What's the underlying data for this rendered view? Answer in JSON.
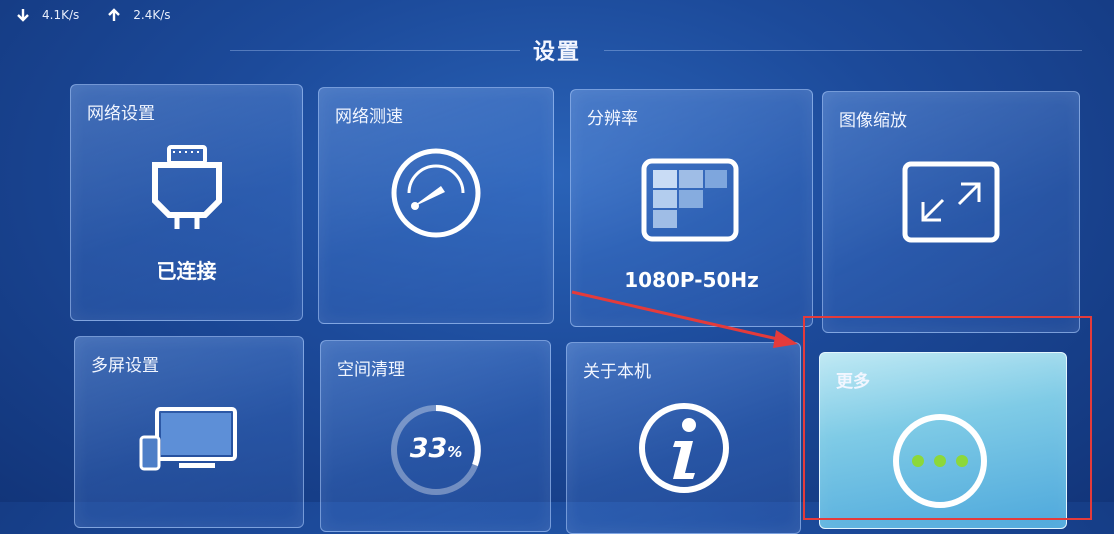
{
  "status": {
    "down_rate": "4.1K/s",
    "up_rate": "2.4K/s"
  },
  "header": {
    "title": "设置"
  },
  "tiles": [
    {
      "label": "网络设置",
      "sub": "已连接",
      "icon": "ethernet-icon"
    },
    {
      "label": "网络测速",
      "sub": "",
      "icon": "speedometer-icon"
    },
    {
      "label": "分辨率",
      "sub": "1080P-50Hz",
      "icon": "resolution-icon"
    },
    {
      "label": "图像缩放",
      "sub": "",
      "icon": "expand-icon"
    },
    {
      "label": "多屏设置",
      "sub": "",
      "icon": "multiscreen-icon"
    },
    {
      "label": "空间清理",
      "sub": "",
      "icon": "storage-cleanup-icon",
      "progress_text": "33",
      "progress_unit": "%"
    },
    {
      "label": "关于本机",
      "sub": "",
      "icon": "info-icon"
    },
    {
      "label": "更多",
      "sub": "",
      "icon": "more-icon"
    }
  ],
  "colors": {
    "highlight": "#e43b3b",
    "more_dots": "#8cd83a"
  }
}
